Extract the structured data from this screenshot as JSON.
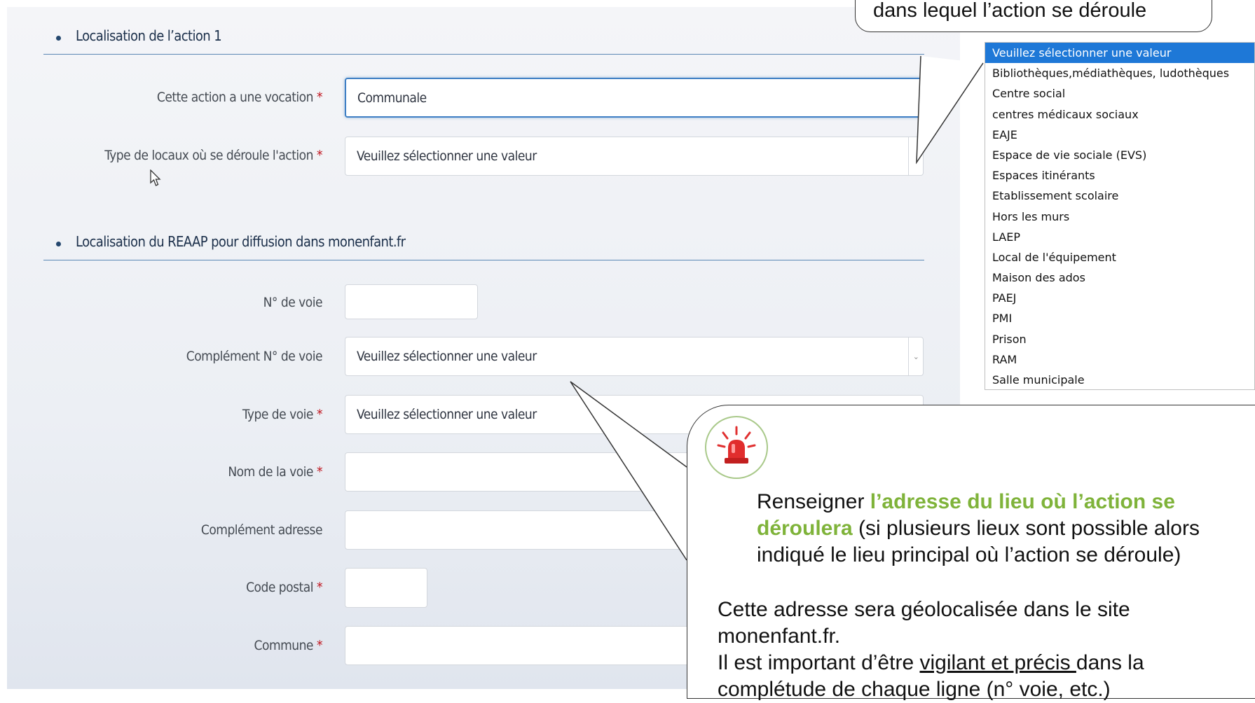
{
  "form": {
    "section1_title": "Localisation de l’action 1",
    "vocation_label": "Cette action a une vocation",
    "vocation_value": "Communale",
    "type_locaux_label": "Type de locaux où se déroule l'action",
    "type_locaux_value": "Veuillez sélectionner une valeur",
    "section2_title": "Localisation du REAAP pour diffusion dans monenfant.fr",
    "num_voie_label": "N° de voie",
    "complement_num_label": "Complément N° de voie",
    "complement_num_value": "Veuillez sélectionner une valeur",
    "type_voie_label": "Type de voie",
    "type_voie_value": "Veuillez sélectionner une valeur",
    "nom_voie_label": "Nom de la voie",
    "complement_adresse_label": "Complément adresse",
    "code_postal_label": "Code postal",
    "commune_label": "Commune",
    "required_mark": "*"
  },
  "dropdown": {
    "options": [
      "Veuillez sélectionner une valeur",
      "Bibliothèques,médiathèques, ludothèques",
      "Centre social",
      "centres médicaux sociaux",
      "EAJE",
      "Espace de vie sociale (EVS)",
      "Espaces itinérants",
      "Etablissement scolaire",
      "Hors les murs",
      "LAEP",
      "Local de l'équipement",
      "Maison des ados",
      "PAEJ",
      "PMI",
      "Prison",
      "RAM",
      "Salle municipale"
    ],
    "selected_index": 0
  },
  "callout_top": {
    "text": "dans lequel l’action se déroule"
  },
  "callout_main": {
    "p1_start": "Renseigner ",
    "p1_highlight": "l’adresse du lieu où l’action se déroulera",
    "p1_end": " (si plusieurs lieux sont possible alors indiqué le lieu principal où l’action se déroule)",
    "p2_line1": "Cette adresse sera géolocalisée dans le site monenfant.fr.",
    "p2_start": "Il est important d’être ",
    "p2_underlined": "vigilant et précis ",
    "p2_end": "dans la complétude de chaque ligne (n° voie, etc.)"
  },
  "colors": {
    "accent": "#1e78d7",
    "highlight_green": "#7fb33a",
    "required_red": "#c0161f",
    "section_line": "#5b88b5"
  },
  "icons": {
    "alert": "siren-icon",
    "pointer": "mouse-cursor-icon",
    "select_arrow": "chevron-down-icon"
  }
}
